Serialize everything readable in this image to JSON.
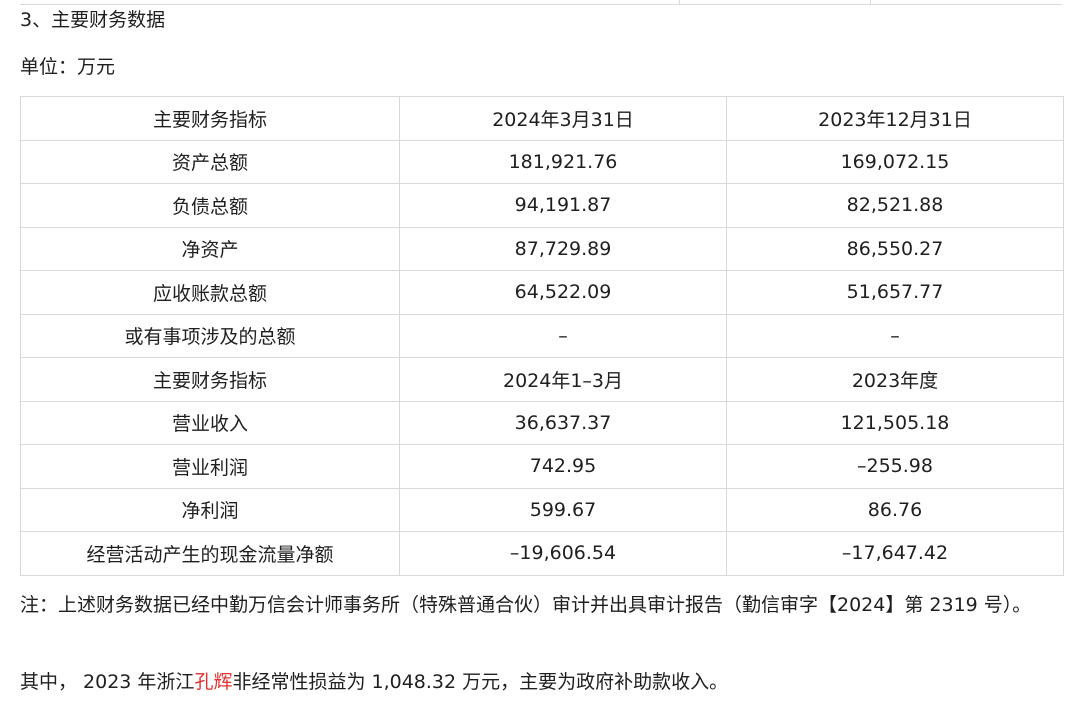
{
  "heading": "3、主要财务数据",
  "unit": "单位：万元",
  "table": {
    "rows": [
      [
        "主要财务指标",
        "2024年3月31日",
        "2023年12月31日"
      ],
      [
        "资产总额",
        "181,921.76",
        "169,072.15"
      ],
      [
        "负债总额",
        "94,191.87",
        "82,521.88"
      ],
      [
        "净资产",
        "87,729.89",
        "86,550.27"
      ],
      [
        "应收账款总额",
        "64,522.09",
        "51,657.77"
      ],
      [
        "或有事项涉及的总额",
        "–",
        "–"
      ],
      [
        "主要财务指标",
        "2024年1–3月",
        "2023年度"
      ],
      [
        "营业收入",
        "36,637.37",
        "121,505.18"
      ],
      [
        "营业利润",
        "742.95",
        "–255.98"
      ],
      [
        "净利润",
        "599.67",
        "86.76"
      ],
      [
        "经营活动产生的现金流量净额",
        "–19,606.54",
        "–17,647.42"
      ]
    ]
  },
  "note": "注：上述财务数据已经中勤万信会计师事务所（特殊普通合伙）审计并出具审计报告（勤信审字【2024】第 2319 号）。",
  "summary": {
    "prefix": "其中， 2023 年浙江",
    "highlight": "孔辉",
    "suffix": "非经常性损益为 1,048.32 万元，主要为政府补助款收入。",
    "highlight_color": "#e0312f"
  }
}
